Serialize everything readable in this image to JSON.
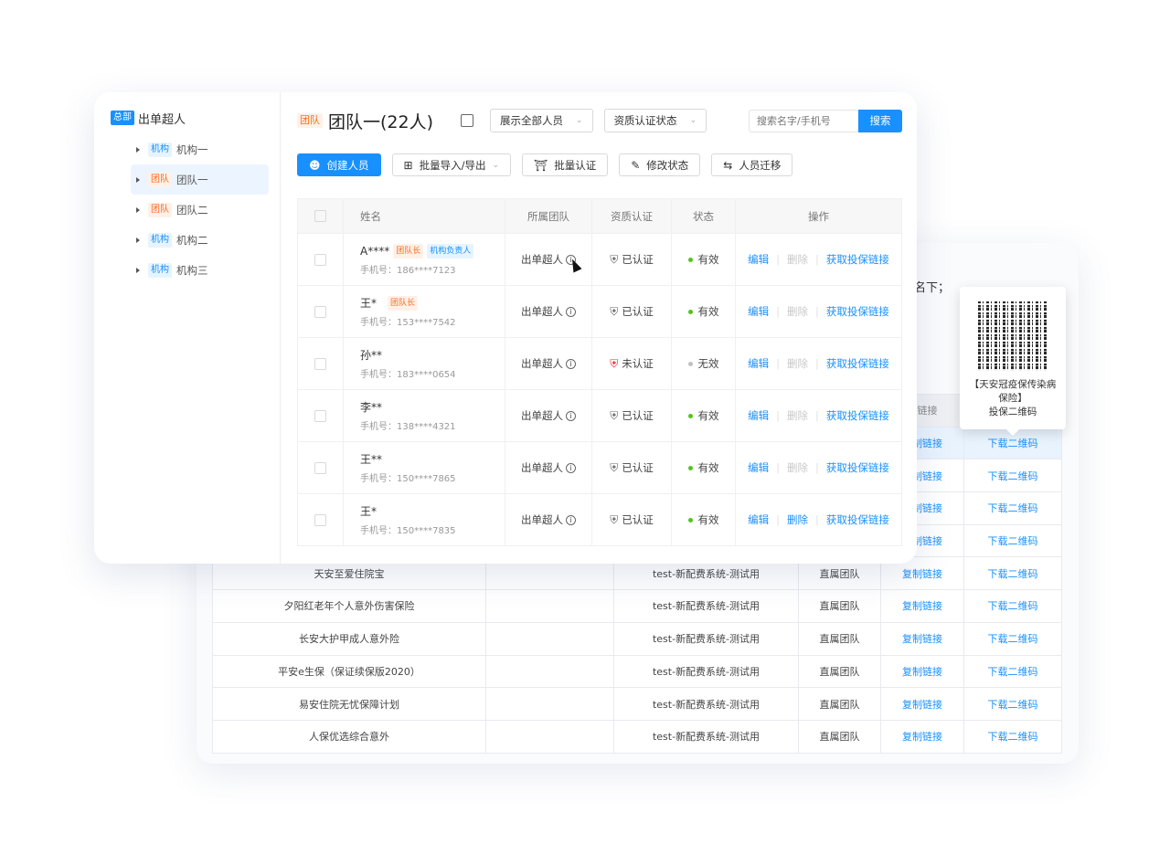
{
  "sidebar": {
    "root": {
      "tag": "总部",
      "label": "出单超人"
    },
    "items": [
      {
        "tag": "机构",
        "type": "org",
        "label": "机构一"
      },
      {
        "tag": "团队",
        "type": "team",
        "label": "团队一",
        "active": true
      },
      {
        "tag": "团队",
        "type": "team",
        "label": "团队二"
      },
      {
        "tag": "机构",
        "type": "org",
        "label": "机构二"
      },
      {
        "tag": "机构",
        "type": "org",
        "label": "机构三"
      }
    ]
  },
  "header": {
    "tag": "团队",
    "title": "团队一(22人)",
    "filter1": "展示全部人员",
    "filter2": "资质认证状态",
    "search_placeholder": "搜索名字/手机号",
    "search_button": "搜索"
  },
  "toolbar": {
    "create": "创建人员",
    "import": "批量导入/导出",
    "certify": "批量认证",
    "modify": "修改状态",
    "migrate": "人员迁移"
  },
  "table": {
    "headers": [
      "姓名",
      "所属团队",
      "资质认证",
      "状态",
      "操作"
    ],
    "rows": [
      {
        "name": "A****",
        "tags": [
          "团队长",
          "机构负责人"
        ],
        "phone": "手机号：186****7123",
        "team": "出单超人",
        "cert": "已认证",
        "status": "有效",
        "edit": "编辑",
        "del": "删除",
        "link": "获取投保链接"
      },
      {
        "name": "王*",
        "tags": [
          "团队长"
        ],
        "phone": "手机号：153****7542",
        "team": "出单超人",
        "cert": "已认证",
        "status": "有效",
        "edit": "编辑",
        "del": "删除",
        "link": "获取投保链接"
      },
      {
        "name": "孙**",
        "tags": [],
        "phone": "手机号：183****0654",
        "team": "出单超人",
        "cert": "未认证",
        "status": "无效",
        "edit": "编辑",
        "del": "删除",
        "link": "获取投保链接"
      },
      {
        "name": "李**",
        "tags": [],
        "phone": "手机号：138****4321",
        "team": "出单超人",
        "cert": "已认证",
        "status": "有效",
        "edit": "编辑",
        "del": "删除",
        "link": "获取投保链接"
      },
      {
        "name": "王**",
        "tags": [],
        "phone": "手机号：150****7865",
        "team": "出单超人",
        "cert": "已认证",
        "status": "有效",
        "edit": "编辑",
        "del": "删除",
        "link": "获取投保链接"
      },
      {
        "name": "王*",
        "tags": [],
        "phone": "手机号：150****7835",
        "team": "出单超人",
        "cert": "已认证",
        "status": "有效",
        "edit": "编辑",
        "del": "删除",
        "link": "获取投保链接"
      }
    ]
  },
  "back_panel": {
    "note": "名下；",
    "header_link": "保链接",
    "rows": [
      {
        "name": "",
        "channel": "",
        "team": "",
        "copy": "复制链接",
        "qr": "下载二维码"
      },
      {
        "name": "",
        "channel": "",
        "team": "",
        "copy": "复制链接",
        "qr": "下载二维码"
      },
      {
        "name": "",
        "channel": "",
        "team": "",
        "copy": "复制链接",
        "qr": "下载二维码"
      },
      {
        "name": "",
        "channel": "",
        "team": "",
        "copy": "复制链接",
        "qr": "下载二维码"
      },
      {
        "name": "天安至爱住院宝",
        "channel": "test-新配费系统-测试用",
        "team": "直属团队",
        "copy": "复制链接",
        "qr": "下载二维码"
      },
      {
        "name": "夕阳红老年个人意外伤害保险",
        "channel": "test-新配费系统-测试用",
        "team": "直属团队",
        "copy": "复制链接",
        "qr": "下载二维码"
      },
      {
        "name": "长安大护甲成人意外险",
        "channel": "test-新配费系统-测试用",
        "team": "直属团队",
        "copy": "复制链接",
        "qr": "下载二维码"
      },
      {
        "name": "平安e生保（保证续保版2020）",
        "channel": "test-新配费系统-测试用",
        "team": "直属团队",
        "copy": "复制链接",
        "qr": "下载二维码"
      },
      {
        "name": "易安住院无忧保障计划",
        "channel": "test-新配费系统-测试用",
        "team": "直属团队",
        "copy": "复制链接",
        "qr": "下载二维码"
      },
      {
        "name": "人保优选综合意外",
        "channel": "test-新配费系统-测试用",
        "team": "直属团队",
        "copy": "复制链接",
        "qr": "下载二维码"
      }
    ]
  },
  "tooltip": {
    "line1": "【天安冠疫保传染病保险】",
    "line2": "投保二维码"
  },
  "colors": {
    "primary": "#1890ff",
    "orange": "#ff6a1f",
    "success": "#52c41a",
    "danger": "#f5222d"
  }
}
